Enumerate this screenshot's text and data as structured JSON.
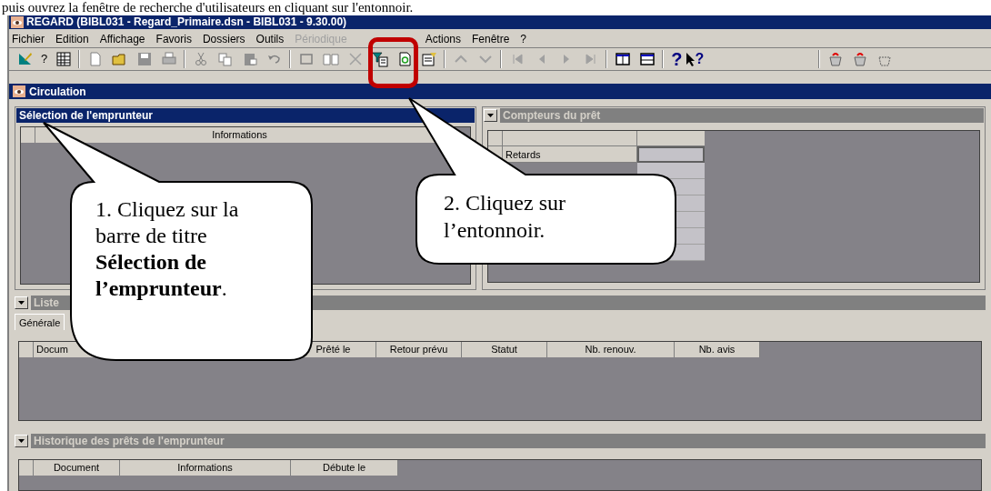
{
  "document_text": "puis ouvrez la fenêtre de recherche d'utilisateurs en cliquant sur l'entonnoir.",
  "window": {
    "title": "REGARD (BIBL031 - Regard_Primaire.dsn - BIBL031 - 9.30.00)"
  },
  "menu": [
    {
      "label": "Fichier",
      "disabled": false
    },
    {
      "label": "Edition",
      "disabled": false
    },
    {
      "label": "Affichage",
      "disabled": false
    },
    {
      "label": "Favoris",
      "disabled": false
    },
    {
      "label": "Dossiers",
      "disabled": false
    },
    {
      "label": "Outils",
      "disabled": false
    },
    {
      "label": "Périodique",
      "disabled": true
    },
    {
      "label": "Actions",
      "disabled": false
    },
    {
      "label": "Fenêtre",
      "disabled": false
    },
    {
      "label": "?",
      "disabled": false
    }
  ],
  "toolbar": {
    "help_glyph": "?",
    "context_help_glyph": "?",
    "whats_this_glyph": "?"
  },
  "child_window": {
    "title": "Circulation"
  },
  "borrower_panel": {
    "title": "Sélection de l'emprunteur",
    "active": true,
    "columns": [
      "Informations"
    ]
  },
  "counters_panel": {
    "title": "Compteurs du prêt",
    "active": false,
    "rows": [
      {
        "label": "Retards"
      }
    ]
  },
  "loans_panel": {
    "title": "Liste",
    "active": false,
    "tabs": [
      {
        "label": "Générale",
        "selected": true
      }
    ],
    "columns": [
      "Docum",
      "Prêté le",
      "Retour prévu",
      "Statut",
      "Nb. renouv.",
      "Nb. avis"
    ]
  },
  "history_panel": {
    "title": "Historique des prêts de l'emprunteur",
    "active": false,
    "columns": [
      "Document",
      "Informations",
      "Débute le"
    ]
  },
  "callouts": [
    {
      "text": "1. Cliquez sur la barre de titre **Sélection de l’emprunteur**."
    },
    {
      "text": "2. Cliquez sur l’entonnoir."
    }
  ]
}
